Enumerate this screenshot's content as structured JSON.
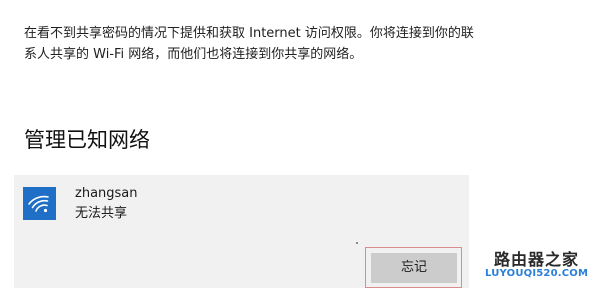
{
  "description": "在看不到共享密码的情况下提供和获取 Internet 访问权限。你将连接到你的联系人共享的 Wi-Fi 网络，而他们也将连接到你共享的网络。",
  "section_title": "管理已知网络",
  "network": {
    "name": "zhangsan",
    "status": "无法共享",
    "icon": "wifi-icon",
    "accent_color": "#1f6fc6"
  },
  "forget_button": {
    "label": "忘记"
  },
  "watermark": {
    "title": "路由器之家",
    "domain": "LUYOUQI520.COM"
  }
}
